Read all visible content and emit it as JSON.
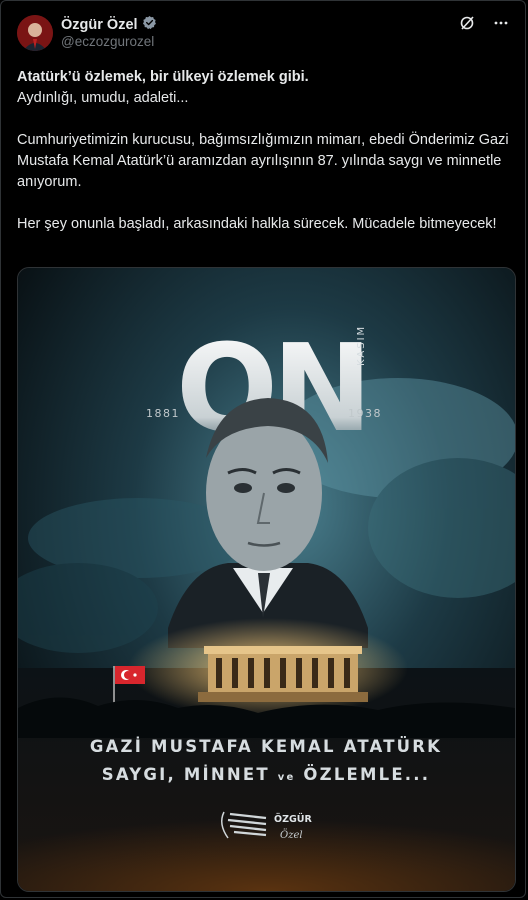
{
  "header": {
    "name": "Özgür Özel",
    "handle": "@eczozgurozel"
  },
  "post": {
    "line1": "Atatürk’ü özlemek, bir ülkeyi özlemek gibi.",
    "line2": "Aydınlığı, umudu, adaleti...",
    "para2": "Cumhuriyetimizin kurucusu, bağımsızlığımızın mimarı, ebedi Önderimiz Gazi Mustafa Kemal Atatürk’ü aramızdan ayrılışının 87. yılında saygı ve minnetle anıyorum.",
    "para3": "Her şey onunla başladı, arkasındaki halkla sürecek. Mücadele bitmeyecek!"
  },
  "poster": {
    "big_text": "ON",
    "month": "KASIM",
    "year_left": "1881",
    "year_right": "1938",
    "line1": "GAZİ MUSTAFA KEMAL ATATÜRK",
    "line2_part1": "SAYGI, MİNNET",
    "line2_ve": "ve",
    "line2_part2": "ÖZLEMLE...",
    "brand": "ÖZGÜR",
    "signature": "Özel"
  },
  "colors": {
    "background": "#000000",
    "text": "#e7e9ea",
    "muted": "#71767b",
    "verified": "#8b98a5",
    "border": "#2f3336"
  },
  "icons": [
    "verified-badge-icon",
    "grok-icon",
    "more-icon"
  ]
}
